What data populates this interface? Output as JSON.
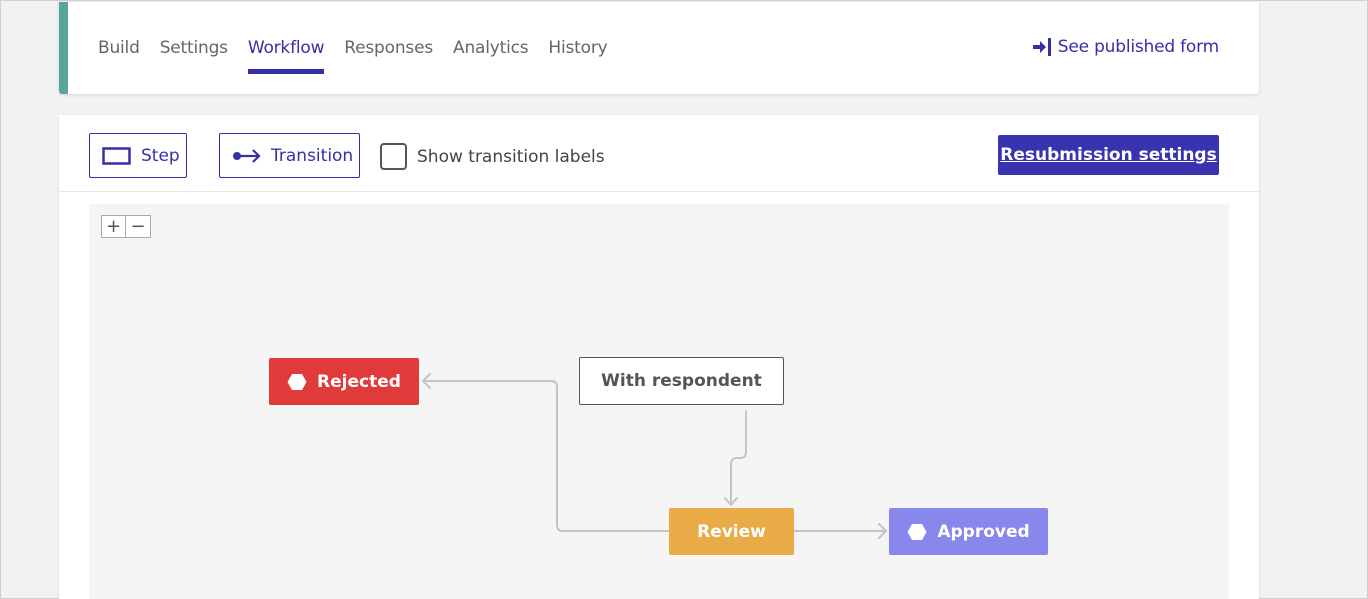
{
  "tabs": [
    {
      "label": "Build"
    },
    {
      "label": "Settings"
    },
    {
      "label": "Workflow"
    },
    {
      "label": "Responses"
    },
    {
      "label": "Analytics"
    },
    {
      "label": "History"
    }
  ],
  "active_tab": "Workflow",
  "header": {
    "published_link": "See published form"
  },
  "toolbar": {
    "step_label": "Step",
    "transition_label": "Transition",
    "show_labels_text": "Show transition labels",
    "show_labels_checked": false,
    "resubmission_label": "Resubmission settings"
  },
  "zoom": {
    "in": "+",
    "out": "−"
  },
  "nodes": {
    "rejected": "Rejected",
    "with_respondent": "With respondent",
    "review": "Review",
    "approved": "Approved"
  },
  "colors": {
    "accent": "#3530a8",
    "teal_stripe": "#5aa59a",
    "rejected": "#e03a3a",
    "review": "#e8ab48",
    "approved": "#8787ec"
  }
}
